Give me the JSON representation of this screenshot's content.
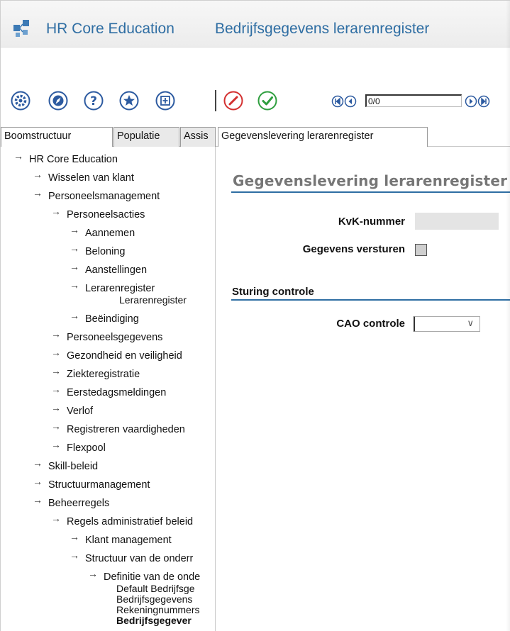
{
  "header": {
    "app_title": "HR Core Education",
    "page_title": "Bedrijfsgegevens lerarenregister"
  },
  "toolbar": {
    "buttons": [
      "settings-icon",
      "compass-icon",
      "help-icon",
      "favorite-star-icon",
      "export-icon",
      "edit-pencil-icon",
      "confirm-check-icon"
    ],
    "record_counter": "0/0"
  },
  "left_tabs": [
    "Boomstructuur",
    "Populatie",
    "Assis"
  ],
  "content_tab": "Gegevenslevering lerarenregister",
  "tree": [
    {
      "label": "HR Core Education"
    },
    {
      "label": "Wisselen van klant"
    },
    {
      "label": "Personeelsmanagement"
    },
    {
      "label": "Personeelsacties"
    },
    {
      "label": "Aannemen"
    },
    {
      "label": "Beloning"
    },
    {
      "label": "Aanstellingen"
    },
    {
      "label": "Lerarenregister",
      "sub": "Lerarenregister"
    },
    {
      "label": "Beëindiging"
    },
    {
      "label": "Personeelsgegevens"
    },
    {
      "label": "Gezondheid en veiligheid"
    },
    {
      "label": "Ziekteregistratie"
    },
    {
      "label": "Eerstedagsmeldingen"
    },
    {
      "label": "Verlof"
    },
    {
      "label": "Registreren vaardigheden"
    },
    {
      "label": "Flexpool"
    },
    {
      "label": "Skill-beleid"
    },
    {
      "label": "Structuurmanagement"
    },
    {
      "label": "Beheerregels"
    },
    {
      "label": "Regels administratief beleid"
    },
    {
      "label": "Klant management"
    },
    {
      "label": "Structuur van de onderr"
    },
    {
      "label": "Definitie van de onde",
      "children": [
        "Default Bedrijfsge",
        "Bedrijfsgegevens",
        "Rekeningnummers",
        "Bedrijfsgegever"
      ]
    }
  ],
  "form": {
    "section_title": "Gegevenslevering lerarenregister",
    "kvk_label": "KvK-nummer",
    "kvk_value": "",
    "send_label": "Gegevens versturen",
    "send_checked": false,
    "control_section": "Sturing controle",
    "cao_label": "CAO controle",
    "cao_value": ""
  },
  "colors": {
    "accent_blue": "#2f6ea3",
    "edit_red": "#d32f2f",
    "confirm_green": "#2e9e3e",
    "toolbar_icon_blue": "#2c5aa0"
  }
}
